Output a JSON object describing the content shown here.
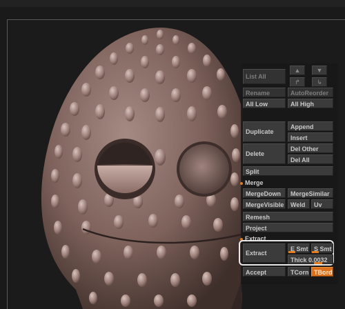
{
  "colors": {
    "accent": "#e07b22",
    "panel_bg": "#3b3b3b",
    "model": "#8c6d66"
  },
  "subtool_panel": {
    "list_all": "List All",
    "rename": "Rename",
    "auto_reorder": "AutoReorder",
    "all_low": "All Low",
    "all_high": "All High",
    "duplicate": "Duplicate",
    "append": "Append",
    "insert": "Insert",
    "delete": "Delete",
    "del_other": "Del Other",
    "del_all": "Del All",
    "split": "Split",
    "merge_header": "Merge",
    "merge_down": "MergeDown",
    "merge_similar": "MergeSimilar",
    "merge_visible": "MergeVisible",
    "weld": "Weld",
    "uv": "Uv",
    "remesh": "Remesh",
    "project": "Project",
    "extract_header": "Extract",
    "extract": "Extract",
    "e_smt": "E Smt",
    "s_smt": "S Smt",
    "thick_label": "Thick",
    "thick_value": "0.0032",
    "accept": "Accept",
    "t_corner": "TCorn",
    "t_border": "TBord"
  },
  "icons": {
    "up_arrow": "arrow-up-icon",
    "down_arrow": "arrow-down-icon",
    "up_right": "arrow-up-right-icon",
    "down_right": "arrow-down-right-icon"
  }
}
